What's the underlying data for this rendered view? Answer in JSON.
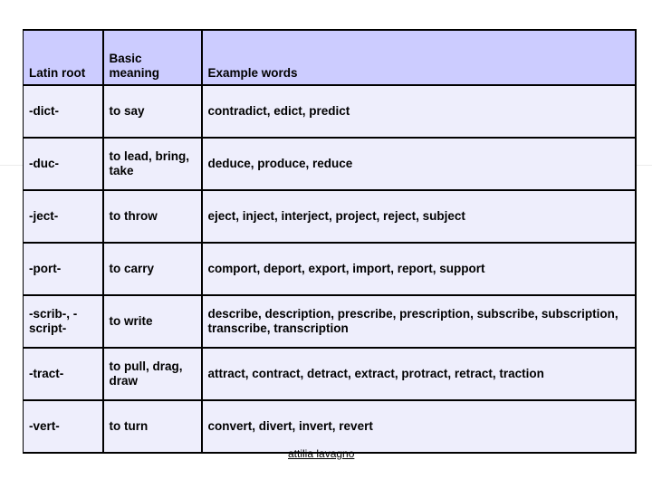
{
  "table": {
    "headers": [
      "Latin root",
      "Basic meaning",
      "Example words"
    ],
    "rows": [
      [
        "-dict-",
        "to say",
        "contradict, edict, predict"
      ],
      [
        "-duc-",
        "to lead, bring, take",
        "deduce, produce, reduce"
      ],
      [
        "-ject-",
        "to throw",
        "eject, inject, interject, project, reject, subject"
      ],
      [
        "-port-",
        "to carry",
        "comport, deport, export, import, report, support"
      ],
      [
        "-scrib-, -script-",
        "to write",
        "describe, description, prescribe, prescription, subscribe, subscription, transcribe, transcription"
      ],
      [
        "-tract-",
        "to pull, drag, draw",
        "attract, contract, detract, extract, protract, retract, traction"
      ],
      [
        "-vert-",
        "to turn",
        "convert, divert, invert, revert"
      ]
    ]
  },
  "footer": {
    "author": "attilia lavagno"
  },
  "colors": {
    "header_bg": "#ccccff",
    "row_bg": "#eeeefc",
    "border": "#000000"
  }
}
